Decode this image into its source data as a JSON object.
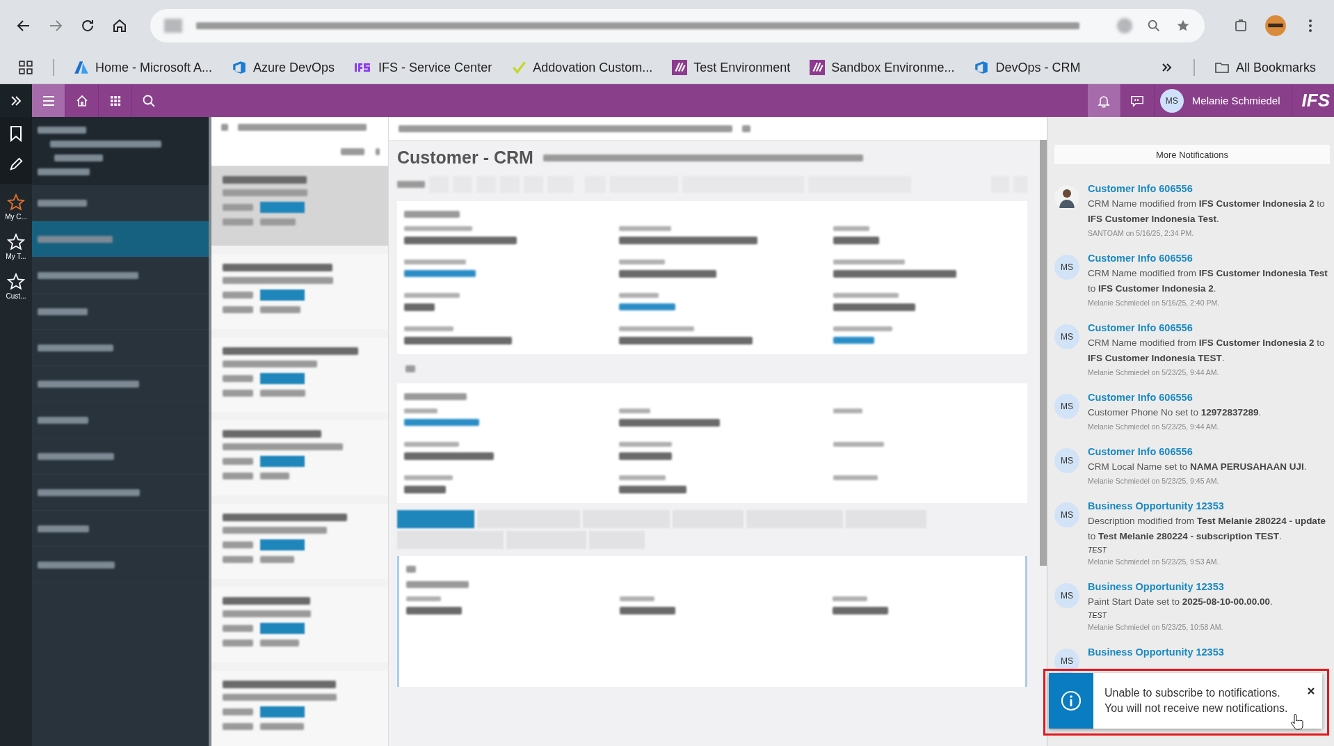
{
  "browser": {
    "bookmarks": [
      {
        "label": "Home - Microsoft A...",
        "kind": "azure"
      },
      {
        "label": "Azure DevOps",
        "kind": "devops"
      },
      {
        "label": "IFS - Service Center",
        "kind": "ifs"
      },
      {
        "label": "Addovation Custom...",
        "kind": "check"
      },
      {
        "label": "Test Environment",
        "kind": "ifsbox"
      },
      {
        "label": "Sandbox Environme...",
        "kind": "ifsbox"
      },
      {
        "label": "DevOps - CRM",
        "kind": "devops"
      }
    ],
    "all_bookmarks": "All Bookmarks"
  },
  "header": {
    "user_initials": "MS",
    "user_name": "Melanie Schmiedel",
    "logo_text": "IFS"
  },
  "rail": {
    "items": [
      {
        "label": "My C...",
        "selected": true
      },
      {
        "label": "My T...",
        "selected": false
      },
      {
        "label": "Cust...",
        "selected": false
      }
    ]
  },
  "nav": {
    "items": [
      {
        "selected": false
      },
      {
        "selected": true
      },
      {
        "selected": false
      },
      {
        "selected": false
      },
      {
        "selected": false
      },
      {
        "selected": false
      },
      {
        "selected": false
      },
      {
        "selected": false
      },
      {
        "selected": false
      },
      {
        "selected": false
      },
      {
        "selected": false
      }
    ]
  },
  "list": {
    "cards": [
      {
        "selected": true
      },
      {
        "selected": false
      },
      {
        "selected": false
      },
      {
        "selected": false
      },
      {
        "selected": false
      },
      {
        "selected": false
      },
      {
        "selected": false
      }
    ]
  },
  "page": {
    "title": "Customer - CRM"
  },
  "tabs": {
    "items": [
      {
        "selected": true
      },
      {
        "selected": false
      },
      {
        "selected": false
      },
      {
        "selected": false
      },
      {
        "selected": false
      },
      {
        "selected": false
      },
      {
        "selected": false
      },
      {
        "selected": false
      },
      {
        "selected": false
      }
    ]
  },
  "notifications": {
    "more_button": "More Notifications",
    "items": [
      {
        "kind": "photo",
        "title": "Customer Info 606556",
        "message": "CRM Name modified from **IFS Customer Indonesia 2** to **IFS Customer Indonesia Test**.",
        "meta": "SANTOAM on 5/16/25, 2:34 PM."
      },
      {
        "kind": "initials",
        "initials": "MS",
        "title": "Customer Info 606556",
        "message": "CRM Name modified from **IFS Customer Indonesia Test** to **IFS Customer Indonesia 2**.",
        "meta": "Melanie Schmiedel on 5/16/25, 2:40 PM."
      },
      {
        "kind": "initials",
        "initials": "MS",
        "title": "Customer Info 606556",
        "message": "CRM Name modified from **IFS Customer Indonesia 2** to **IFS Customer Indonesia TEST**.",
        "meta": "Melanie Schmiedel on 5/23/25, 9:44 AM."
      },
      {
        "kind": "initials",
        "initials": "MS",
        "title": "Customer Info 606556",
        "message": "Customer Phone No set to **12972837289**.",
        "meta": "Melanie Schmiedel on 5/23/25, 9:44 AM."
      },
      {
        "kind": "initials",
        "initials": "MS",
        "title": "Customer Info 606556",
        "message": "CRM Local Name set to **NAMA PERUSAHAAN UJI**.",
        "meta": "Melanie Schmiedel on 5/23/25, 9:45 AM."
      },
      {
        "kind": "initials",
        "initials": "MS",
        "title": "Business Opportunity 12353",
        "message": "Description modified from **Test Melanie 280224 - update** to **Test Melanie 280224 - subscription TEST**.",
        "note": "TEST",
        "meta": "Melanie Schmiedel on 5/23/25, 9:53 AM."
      },
      {
        "kind": "initials",
        "initials": "MS",
        "title": "Business Opportunity 12353",
        "message": "Paint Start Date set to **2025-08-10-00.00.00**.",
        "note": "TEST",
        "meta": "Melanie Schmiedel on 5/23/25, 10:58 AM."
      },
      {
        "kind": "initials",
        "initials": "MS",
        "title": "Business Opportunity 12353"
      }
    ]
  },
  "toast": {
    "lines": [
      "Unable to subscribe to notifications.",
      "You will not receive new notifications."
    ]
  }
}
